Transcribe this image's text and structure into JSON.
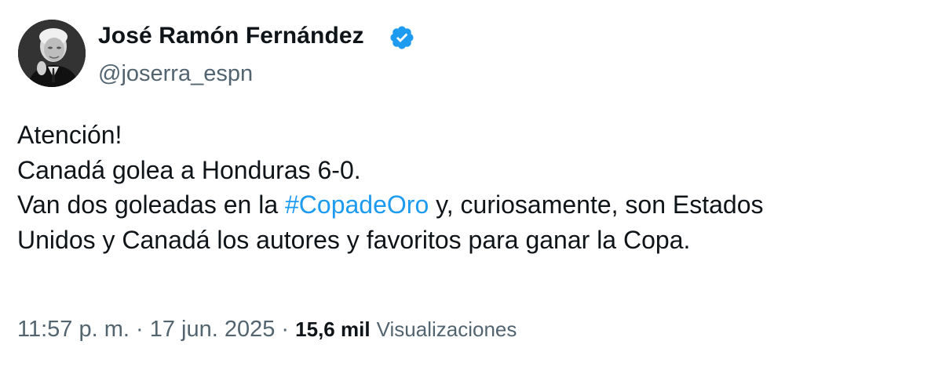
{
  "author": {
    "name": "José Ramón Fernández",
    "handle": "@joserra_espn",
    "verified_icon": "verified-check-icon",
    "verified_color": "#1d9bf0"
  },
  "tweet": {
    "line1": "Atención!",
    "line2": "Canadá golea a Honduras 6-0.",
    "line3_before": "Van dos goleadas en la ",
    "hashtag": "#CopadeOro",
    "line3_after": " y, curiosamente, son Estados",
    "line4": "Unidos y Canadá los autores y favoritos para ganar la Copa.",
    "hashtag_color": "#1d9bf0"
  },
  "meta": {
    "time": "11:57 p. m.",
    "separator": " · ",
    "date": "17 jun. 2025",
    "views_count": "15,6 mil",
    "views_label": "Visualizaciones"
  }
}
